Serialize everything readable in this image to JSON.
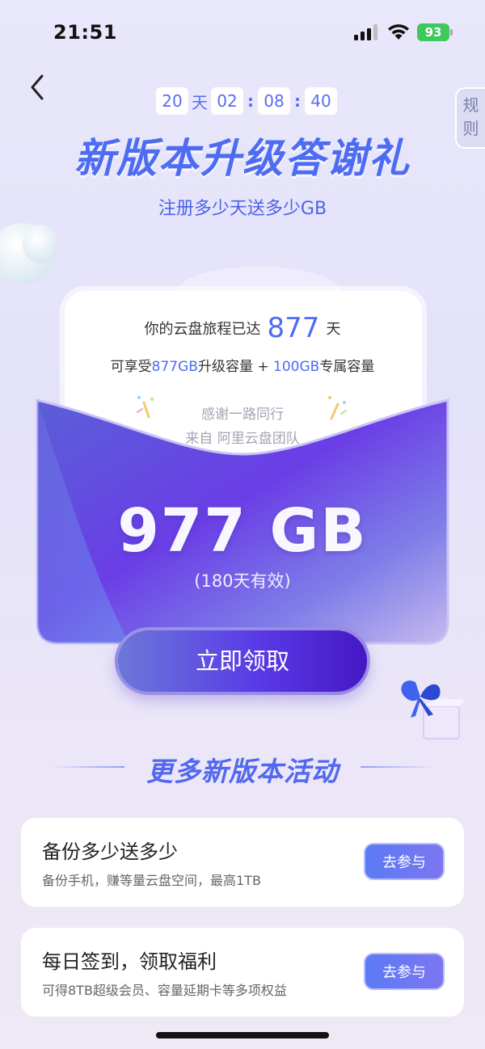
{
  "status_bar": {
    "time": "21:51",
    "battery": "93"
  },
  "countdown": {
    "days": "20",
    "days_unit": "天",
    "hours": "02",
    "minutes": "08",
    "seconds": "40",
    "separator": ":"
  },
  "rules_tab": {
    "line1": "规",
    "line2": "则"
  },
  "header": {
    "title": "新版本升级答谢礼",
    "subtitle": "注册多少天送多少GB"
  },
  "letter": {
    "journey_prefix": "你的云盘旅程已达",
    "journey_days": "877",
    "journey_suffix": "天",
    "benefit_prefix": "可享受",
    "benefit_upgrade": "877GB",
    "benefit_mid": "升级容量 + ",
    "benefit_exclusive": "100GB",
    "benefit_suffix": "专属容量",
    "thanks": "感谢一路同行",
    "from": "来自 阿里云盘团队"
  },
  "reward": {
    "amount": "977 GB",
    "validity": "(180天有效)",
    "claim_label": "立即领取"
  },
  "more_section": {
    "title": "更多新版本活动"
  },
  "activities": [
    {
      "title": "备份多少送多少",
      "desc": "备份手机，赚等量云盘空间，最高1TB",
      "button": "去参与"
    },
    {
      "title": "每日签到，领取福利",
      "desc": "可得8TB超级会员、容量延期卡等多项权益",
      "button": "去参与"
    }
  ],
  "colors": {
    "accent": "#4e6cf2",
    "envelope_dark": "#5b2de0",
    "battery": "#3ec95c"
  }
}
